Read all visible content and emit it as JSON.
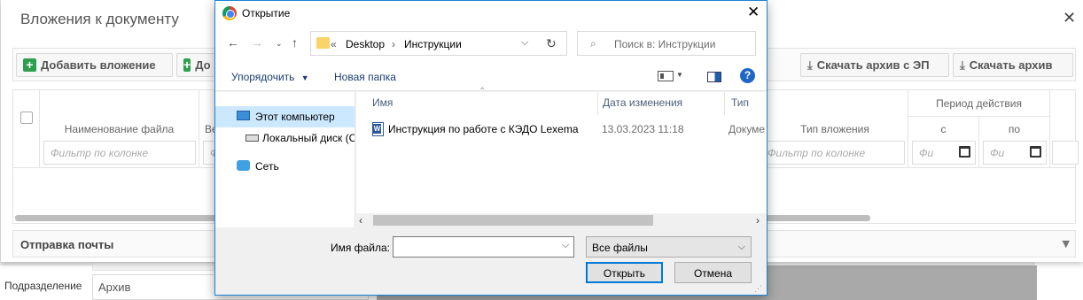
{
  "background": {
    "field_label": "Подразделение",
    "field_value": "Архив"
  },
  "attachments_dialog": {
    "title": "Вложения к документу",
    "toolbar": {
      "add_attachment": "Добавить вложение",
      "add_second_partial": "До",
      "download_archive_ep": "Скачать архив с ЭП",
      "download_archive": "Скачать архив"
    },
    "grid": {
      "columns": {
        "file_name": "Наименование файла",
        "partial": "Ве",
        "attachment_type": "Тип вложения",
        "validity_period": "Период действия",
        "from": "с",
        "to": "по"
      },
      "filter_placeholder": "Фильтр по колонке",
      "filter_partial_placeholder": "Фи",
      "date_placeholder": "Фи"
    },
    "mail_section": "Отправка почты"
  },
  "open_dialog": {
    "title": "Открытие",
    "address": {
      "prefix": "«",
      "segments": [
        "Desktop",
        "Инструкции"
      ]
    },
    "search_placeholder": "Поиск в: Инструкции",
    "commands": {
      "organize": "Упорядочить",
      "new_folder": "Новая папка"
    },
    "nav": [
      {
        "label": "Этот компьютер",
        "icon": "computer-icon",
        "selected": true
      },
      {
        "label": "Локальный диск (С",
        "icon": "drive-icon",
        "selected": false
      },
      {
        "label": "Сеть",
        "icon": "network-icon",
        "selected": false
      }
    ],
    "columns": {
      "name": "Имя",
      "modified": "Дата изменения",
      "type": "Тип"
    },
    "files": [
      {
        "name": "Инструкция по работе с КЭДО Lexema",
        "modified": "13.03.2023 11:18",
        "type": "Докуме"
      }
    ],
    "file_name_label": "Имя файла:",
    "file_name_value": "",
    "file_type": "Все файлы",
    "open_button": "Открыть",
    "cancel_button": "Отмена"
  }
}
